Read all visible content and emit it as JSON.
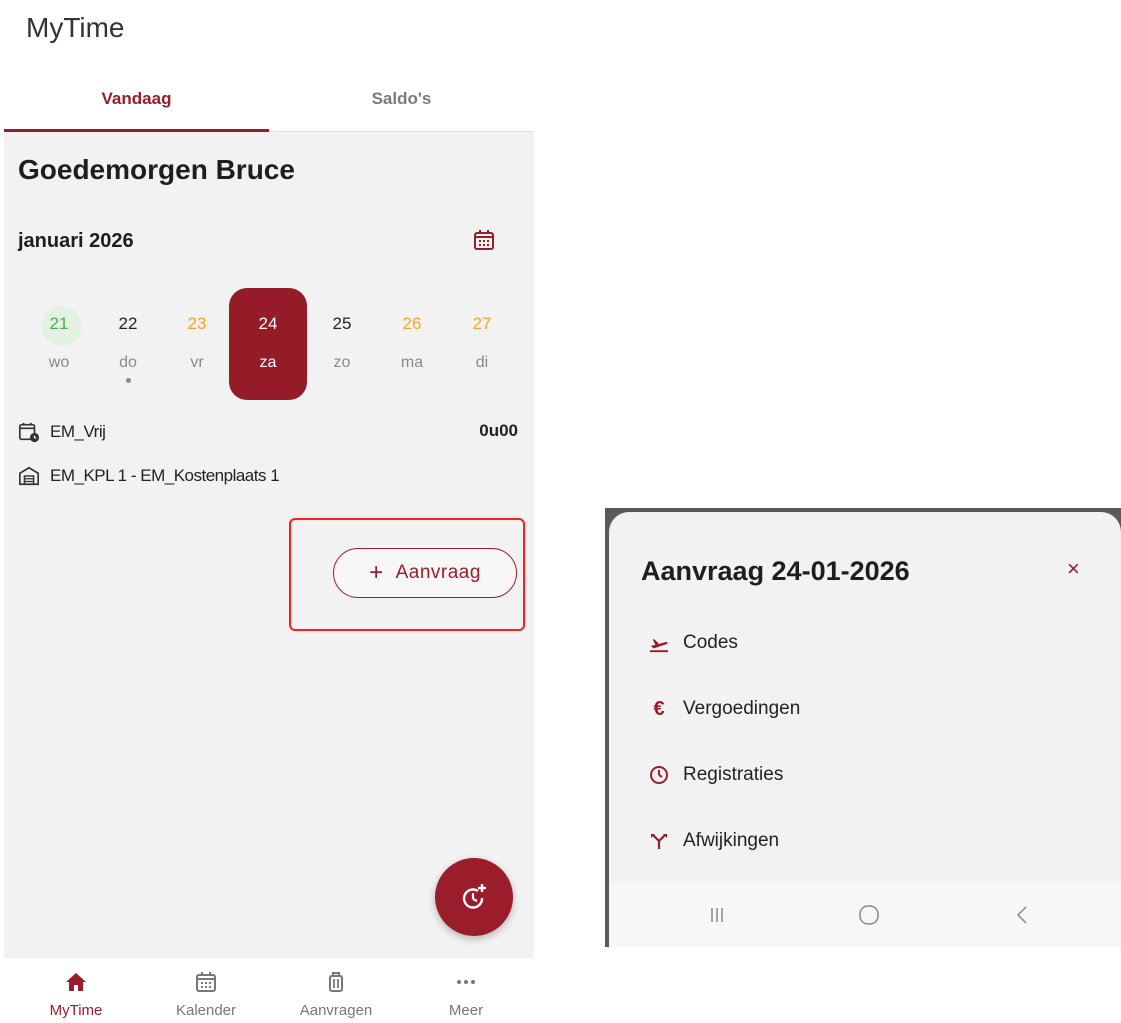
{
  "app": {
    "title": "MyTime"
  },
  "tabs": [
    {
      "label": "Vandaag",
      "active": true
    },
    {
      "label": "Saldo's",
      "active": false
    }
  ],
  "today": {
    "greeting": "Goedemorgen Bruce",
    "month": "januari 2026",
    "days": [
      {
        "num": "21",
        "name": "wo",
        "color": "#4caf50"
      },
      {
        "num": "22",
        "name": "do",
        "color": "#222222"
      },
      {
        "num": "23",
        "name": "vr",
        "color": "#f5a623"
      },
      {
        "num": "24",
        "name": "za",
        "color": "#ffffff"
      },
      {
        "num": "25",
        "name": "zo",
        "color": "#222222"
      },
      {
        "num": "26",
        "name": "ma",
        "color": "#f5a623"
      },
      {
        "num": "27",
        "name": "di",
        "color": "#f5a623"
      }
    ],
    "schedule": "EM_Vrij",
    "hours": "0u00",
    "cost_center": "EM_KPL 1 - EM_Kostenplaats 1",
    "request_button": "Aanvraag"
  },
  "bottom_nav": [
    {
      "label": "MyTime",
      "icon": "home-icon"
    },
    {
      "label": "Kalender",
      "icon": "calendar-icon"
    },
    {
      "label": "Aanvragen",
      "icon": "luggage-icon"
    },
    {
      "label": "Meer",
      "icon": "more-icon"
    }
  ],
  "sheet": {
    "title": "Aanvraag 24-01-2026",
    "close": "×",
    "items": [
      {
        "label": "Codes",
        "icon": "plane-takeoff-icon"
      },
      {
        "label": "Vergoedingen",
        "icon": "euro-icon"
      },
      {
        "label": "Registraties",
        "icon": "clock-icon"
      },
      {
        "label": "Afwijkingen",
        "icon": "fork-icon"
      }
    ]
  },
  "colors": {
    "accent": "#9b1c2b",
    "highlight": "#ff1c1c",
    "background": "#f2f2f2"
  }
}
